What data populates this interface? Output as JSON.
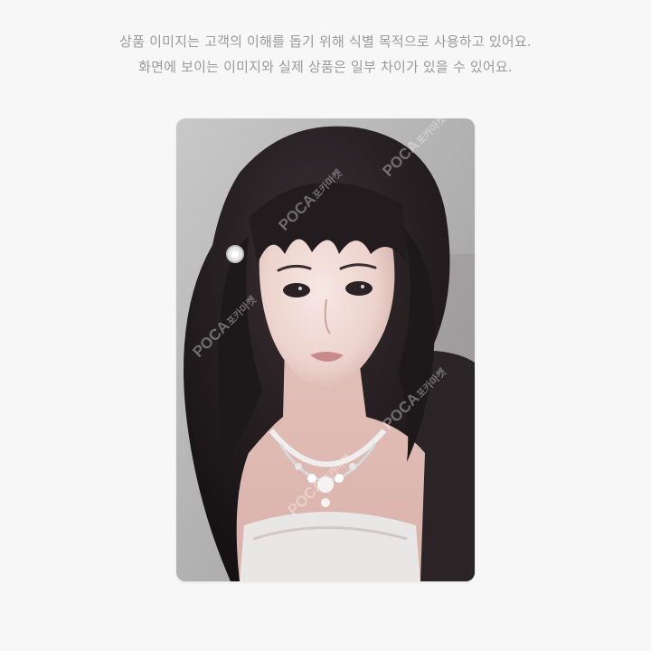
{
  "notice": {
    "line1": "상품 이미지는 고객의 이해를 돕기 위해 식별 목적으로 사용하고 있어요.",
    "line2": "화면에 보이는 이미지와 실제 상품은 일부 차이가 있을 수 있어요."
  },
  "photocard": {
    "watermark_brand": "POCA",
    "watermark_text": "포카마켓"
  },
  "colors": {
    "background": "#f7f7f7",
    "notice_text": "#9a9a9a",
    "photo_backdrop": "#b9b8b8",
    "hair": "#1f1a1c"
  }
}
